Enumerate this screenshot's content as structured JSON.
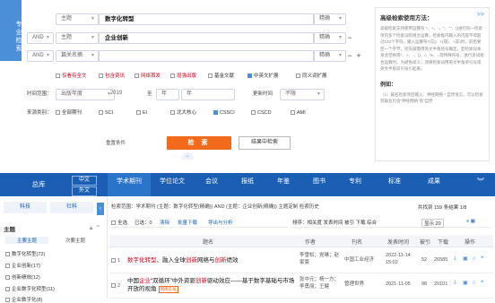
{
  "side_tab": "专业检索",
  "search": {
    "rows": [
      {
        "logic": "",
        "field": "主题",
        "value": "数字化转型",
        "match": "精确"
      },
      {
        "logic": "AND",
        "field": "主题",
        "value": "企业创新",
        "match": "精确"
      },
      {
        "logic": "AND",
        "field": "篇关名摘",
        "value": "",
        "match": "精确"
      }
    ],
    "options": [
      "仅看有全文",
      "包含资讯",
      "网络首发",
      "增强出版",
      "基金文献",
      "中英文扩展",
      "同义词扩展"
    ],
    "options_on": [
      false,
      false,
      false,
      false,
      false,
      true,
      false
    ],
    "time_label": "时间范围：",
    "date_from": "出版年度",
    "year_from": "2019",
    "to": "至",
    "year_to": "年",
    "update_label": "更新时间",
    "update_val": "不限",
    "source_label": "来源类别：",
    "sources": [
      "全部期刊",
      "SCI",
      "EI",
      "北大核心",
      "CSSCI",
      "CSCD",
      "AMI"
    ],
    "sources_on": [
      false,
      false,
      false,
      false,
      true,
      false,
      false
    ],
    "reset": "重置条件",
    "search_btn": "检 索",
    "result_search": "结果中检索"
  },
  "help": {
    "title": "高级检索使用方法：",
    "arrow": ">>",
    "body": "高级检索支持使用运算符 *、+、-、''、\"\"、()进行同一检索项内多个检索词的组合运算，检索框内输入的内容不得超过120个字符。输入运算符*(与)、+(或)、-(非)时，前后要空一个字节，优先级需用英文半角括号确定。若检索词本身含空格或*、+、-、()、/、%、=等特殊符号，进行多词组合运算时，为避免歧义，须将检索词用英文半角单引号或英文半角双引号引起来。",
    "example_title": "例如：",
    "example": "（1）篇名检索项后输入：神经网络 * 自然语言，可以检索到篇名包含“神经网络”及“自然"
  },
  "nav": {
    "home": "总库",
    "sub1": "中文",
    "sub2": "外文",
    "tabs": [
      {
        "label": "学术期刊",
        "count": ""
      },
      {
        "label": "学位论文",
        "count": ""
      },
      {
        "label": "会议",
        "count": ""
      },
      {
        "label": "报纸",
        "count": ""
      },
      {
        "label": "年鉴",
        "count": ""
      },
      {
        "label": "图书",
        "count": ""
      },
      {
        "label": "专利",
        "count": ""
      },
      {
        "label": "标准",
        "count": ""
      },
      {
        "label": "成果",
        "count": ""
      }
    ]
  },
  "sidebar": {
    "tab1": "科技",
    "tab2": "社科",
    "heading": "主题",
    "sub1": "主要主题",
    "sub2": "次要主题",
    "items": [
      "数字化转型(72)",
      "企业创新(17)",
      "创新绩效(12)",
      "企业数字化转型(11)",
      "企业数字化(8)"
    ]
  },
  "results": {
    "crumb": "检索范围：学术期刊  (主题：数字化转型(精确)) AND (主题：企业创新(精确))  主题定制  检索历史",
    "btn1": "主题定制",
    "btn2": "检索历史",
    "count": "共找到 159 条结果   1/8",
    "toolbar": {
      "select_all": "全选",
      "selected": "已选：0",
      "clear": "清除",
      "batch": "批量下载",
      "export": "导出与分析",
      "sort": "排序：相关度  发表时间  被引  下载  综合",
      "display": "显示 20",
      "view": "≡ ▦"
    },
    "columns": [
      "题名",
      "作者",
      "刊名",
      "发表时间",
      "被引",
      "下载",
      "操作"
    ],
    "rows": [
      {
        "n": "1",
        "title_a": "数字化转型",
        "title_b": "、融入全球",
        "title_c": "创新",
        "title_d": "网络与",
        "title_e": "创新",
        "title_f": "绩效",
        "authors": "李雪松；党琳；赵家豪",
        "journal": "中国工业经济",
        "date": "2022-11-14 15:02",
        "cite": "52",
        "down": "26585"
      },
      {
        "n": "2",
        "title_a": "中国",
        "title_b": "企业",
        "title_c": "“双循环”中外资驱",
        "title_d": "创新",
        "title_e": "",
        "title_f": "驱动效应——基于数字基础与市场开放的视角",
        "tag": "网络首发",
        "authors": "张中元；杨一方；李勇丽；王健",
        "journal": "管理世界",
        "date": "2021-11-05",
        "cite": "98",
        "down": "20101"
      }
    ]
  }
}
